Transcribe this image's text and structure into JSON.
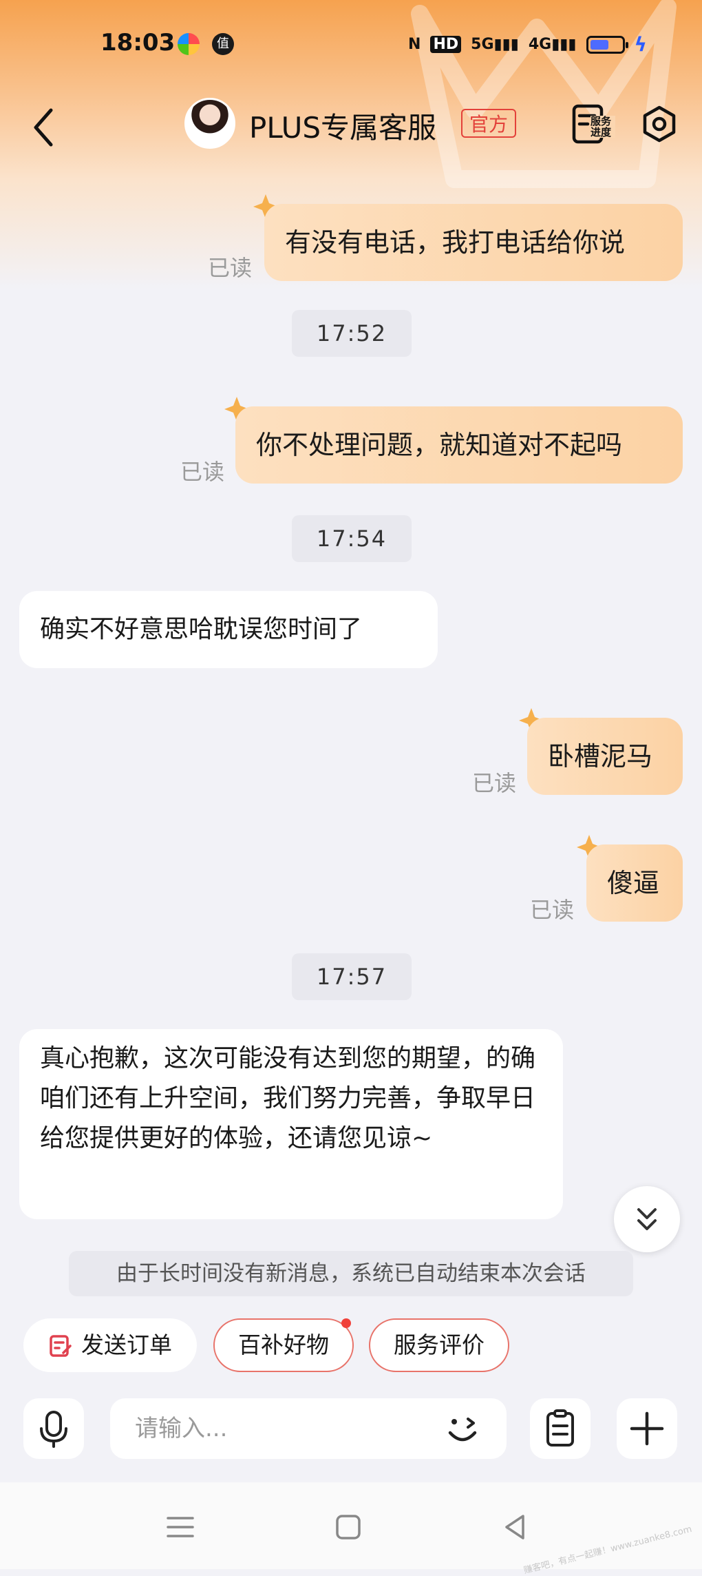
{
  "status_bar": {
    "time": "18:03",
    "icons": [
      "colorful-app-icon",
      "zhi-app-icon",
      "nfc-icon",
      "hd-icon",
      "5g-signal-icon",
      "4g-signal-icon",
      "battery-icon",
      "charging-icon"
    ],
    "battery_level": 0.6
  },
  "header": {
    "title": "PLUS专属客服",
    "badge": "官方",
    "progress_label": "服务进度"
  },
  "messages": [
    {
      "type": "out",
      "text": "有没有电话，我打电话给你说",
      "status": "已读"
    },
    {
      "type": "time",
      "text": "17:52"
    },
    {
      "type": "out",
      "text": "你不处理问题，就知道对不起吗",
      "status": "已读"
    },
    {
      "type": "time",
      "text": "17:54"
    },
    {
      "type": "in",
      "text": "确实不好意思哈耽误您时间了"
    },
    {
      "type": "out",
      "text": "卧槽泥马",
      "status": "已读"
    },
    {
      "type": "out",
      "text": "傻逼",
      "status": "已读"
    },
    {
      "type": "time",
      "text": "17:57"
    },
    {
      "type": "in",
      "text": "真心抱歉，这次可能没有达到您的期望，的确咱们还有上升空间，我们努力完善，争取早日给您提供更好的体验，还请您见谅~"
    }
  ],
  "system_note": "由于长时间没有新消息，系统已自动结束本次会话",
  "quick_actions": {
    "send_order": "发送订单",
    "subsidy": "百补好物",
    "rate_service": "服务评价"
  },
  "input": {
    "placeholder": "请输入..."
  },
  "colors": {
    "accent": "#f6a24f",
    "bubble_out": "#fcd2a4",
    "badge_red": "#e3413a"
  },
  "watermark": "赚客吧，有点一起赚！www.zuanke8.com"
}
